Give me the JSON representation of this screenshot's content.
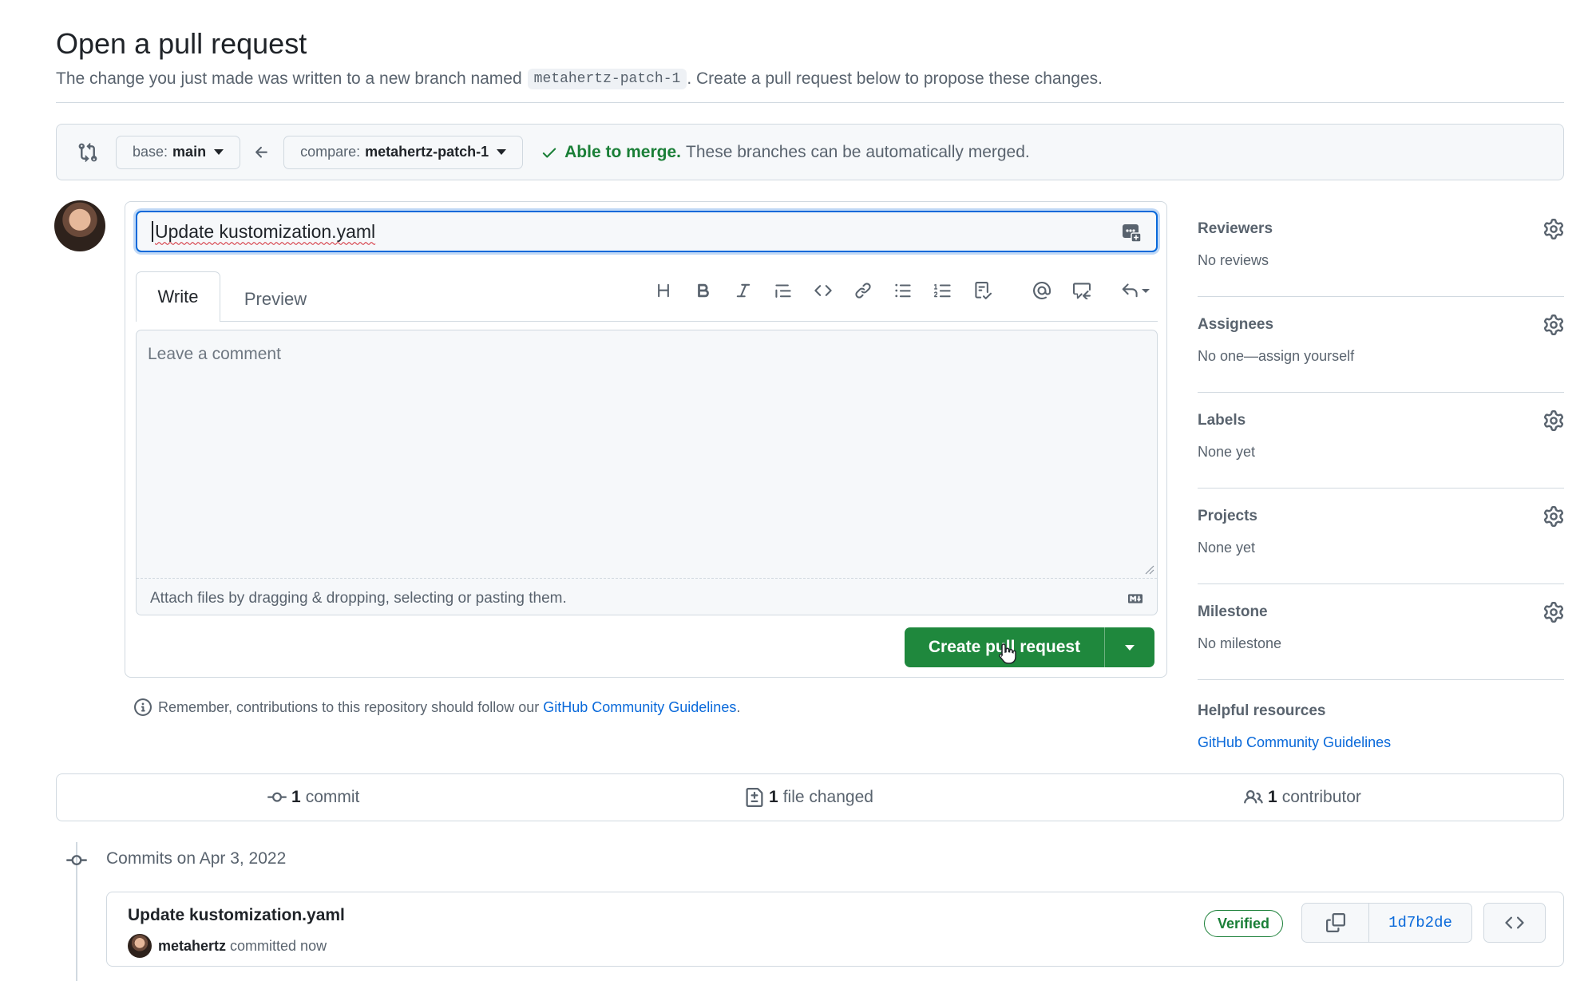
{
  "header": {
    "title": "Open a pull request",
    "subtitle_before": "The change you just made was written to a new branch named",
    "branch_name": "metahertz-patch-1",
    "subtitle_after": ". Create a pull request below to propose these changes."
  },
  "compare": {
    "base_prefix": "base:",
    "base_branch": "main",
    "compare_prefix": "compare:",
    "compare_branch": "metahertz-patch-1",
    "merge_status": "Able to merge.",
    "merge_detail": "These branches can be automatically merged."
  },
  "form": {
    "title_value": "Update kustomization.yaml",
    "tabs": [
      "Write",
      "Preview"
    ],
    "comment_placeholder": "Leave a comment",
    "attach_text": "Attach files by dragging & dropping, selecting or pasting them.",
    "submit_label": "Create pull request",
    "toolbar_icons": [
      "heading-icon",
      "bold-icon",
      "italic-icon",
      "quote-icon",
      "code-icon",
      "link-icon",
      "unordered-list-icon",
      "ordered-list-icon",
      "task-list-icon",
      "mention-icon",
      "reference-icon",
      "saved-replies-icon"
    ]
  },
  "remember": {
    "text": "Remember, contributions to this repository should follow our",
    "link": "GitHub Community Guidelines",
    "suffix": "."
  },
  "sidebar": {
    "items": [
      {
        "label": "Reviewers",
        "value": "No reviews"
      },
      {
        "label": "Assignees",
        "value": "No one—assign yourself"
      },
      {
        "label": "Labels",
        "value": "None yet"
      },
      {
        "label": "Projects",
        "value": "None yet"
      },
      {
        "label": "Milestone",
        "value": "No milestone"
      }
    ],
    "help_heading": "Helpful resources",
    "help_link": "GitHub Community Guidelines"
  },
  "stats": {
    "commits_count": "1",
    "commits_label": "commit",
    "files_count": "1",
    "files_label": "file changed",
    "contributors_count": "1",
    "contributors_label": "contributor"
  },
  "commits": {
    "date_heading": "Commits on Apr 3, 2022",
    "items": [
      {
        "title": "Update kustomization.yaml",
        "author": "metahertz",
        "time": "committed now",
        "badge": "Verified",
        "sha": "1d7b2de"
      }
    ]
  },
  "colors": {
    "accent": "#0969da",
    "success": "#1f883d",
    "success_text": "#1a7f37",
    "border": "#d1d9e0"
  }
}
